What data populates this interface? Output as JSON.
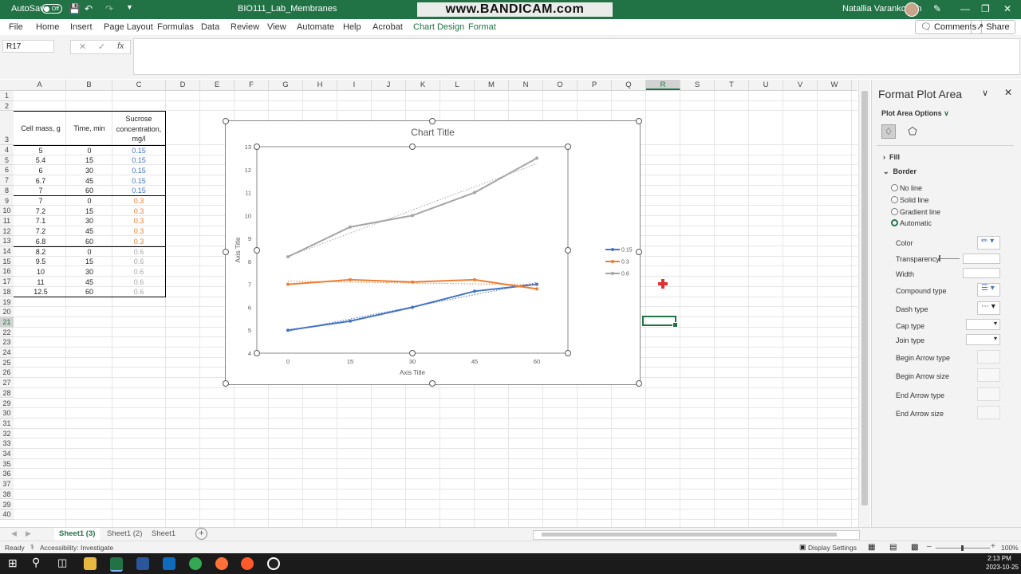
{
  "titlebar": {
    "autosave": "AutoSave",
    "autosave_state": "Off",
    "filename": "BIO111_Lab_Membranes",
    "user": "Natallia Varankovich",
    "watermark": "www.BANDICAM.com"
  },
  "ribbon": {
    "tabs": [
      "File",
      "Home",
      "Insert",
      "Page Layout",
      "Formulas",
      "Data",
      "Review",
      "View",
      "Automate",
      "Help",
      "Acrobat",
      "Chart Design",
      "Format"
    ],
    "comments": "Comments",
    "share": "Share"
  },
  "formula_bar": {
    "name_box": "R17",
    "fx": "fx",
    "value": ""
  },
  "columns": [
    "A",
    "B",
    "C",
    "D",
    "E",
    "F",
    "G",
    "H",
    "I",
    "J",
    "K",
    "L",
    "M",
    "N",
    "O",
    "P",
    "Q",
    "R",
    "S",
    "T",
    "U",
    "V",
    "W"
  ],
  "selected_column": "R",
  "selected_row": 21,
  "row_count": 41,
  "table": {
    "header": [
      "Cell mass, g",
      "Time, min",
      "Sucrose concentration, mg/l"
    ],
    "rows": [
      [
        "5",
        "0",
        "0.15"
      ],
      [
        "5.4",
        "15",
        "0.15"
      ],
      [
        "6",
        "30",
        "0.15"
      ],
      [
        "6.7",
        "45",
        "0.15"
      ],
      [
        "7",
        "60",
        "0.15"
      ],
      [
        "7",
        "0",
        "0.3"
      ],
      [
        "7.2",
        "15",
        "0.3"
      ],
      [
        "7.1",
        "30",
        "0.3"
      ],
      [
        "7.2",
        "45",
        "0.3"
      ],
      [
        "6.8",
        "60",
        "0.3"
      ],
      [
        "8.2",
        "0",
        "0.6"
      ],
      [
        "9.5",
        "15",
        "0.6"
      ],
      [
        "10",
        "30",
        "0.6"
      ],
      [
        "11",
        "45",
        "0.6"
      ],
      [
        "12.5",
        "60",
        "0.6"
      ]
    ]
  },
  "colors": {
    "s015": "#4472c4",
    "s03": "#ed7d31",
    "s06": "#a5a5a5",
    "excel_green": "#217346"
  },
  "chart_data": {
    "type": "line",
    "title": "Chart Title",
    "xlabel": "Axis Title",
    "ylabel": "Axis Title",
    "categories": [
      "0",
      "15",
      "30",
      "45",
      "60"
    ],
    "ylim": [
      4,
      13
    ],
    "yticks": [
      "4",
      "5",
      "6",
      "7",
      "8",
      "9",
      "10",
      "11",
      "12",
      "13"
    ],
    "series": [
      {
        "name": "0.15",
        "values": [
          5,
          5.4,
          6,
          6.7,
          7
        ],
        "color": "#4472c4"
      },
      {
        "name": "0.3",
        "values": [
          7,
          7.2,
          7.1,
          7.2,
          6.8
        ],
        "color": "#ed7d31"
      },
      {
        "name": "0.6",
        "values": [
          8.2,
          9.5,
          10,
          11,
          12.5
        ],
        "color": "#a5a5a5"
      }
    ],
    "trendlines": "linear dotted",
    "legend": "right",
    "grid": false
  },
  "pane": {
    "title": "Format Plot Area",
    "options": "Plot Area Options",
    "fill": "Fill",
    "border": "Border",
    "radios": [
      "No line",
      "Solid line",
      "Gradient line",
      "Automatic"
    ],
    "selected_radio": "Automatic",
    "props": [
      "Color",
      "Transparency",
      "Width",
      "Compound type",
      "Dash type",
      "Cap type",
      "Join type",
      "Begin Arrow type",
      "Begin Arrow size",
      "End Arrow type",
      "End Arrow size"
    ]
  },
  "sheets": [
    "Sheet1 (3)",
    "Sheet1 (2)",
    "Sheet1"
  ],
  "status": {
    "ready": "Ready",
    "accessibility": "Accessibility: Investigate",
    "display": "Display Settings",
    "zoom": "100%"
  },
  "taskbar": {
    "time": "2:13 PM",
    "date": "2023-10-25"
  }
}
